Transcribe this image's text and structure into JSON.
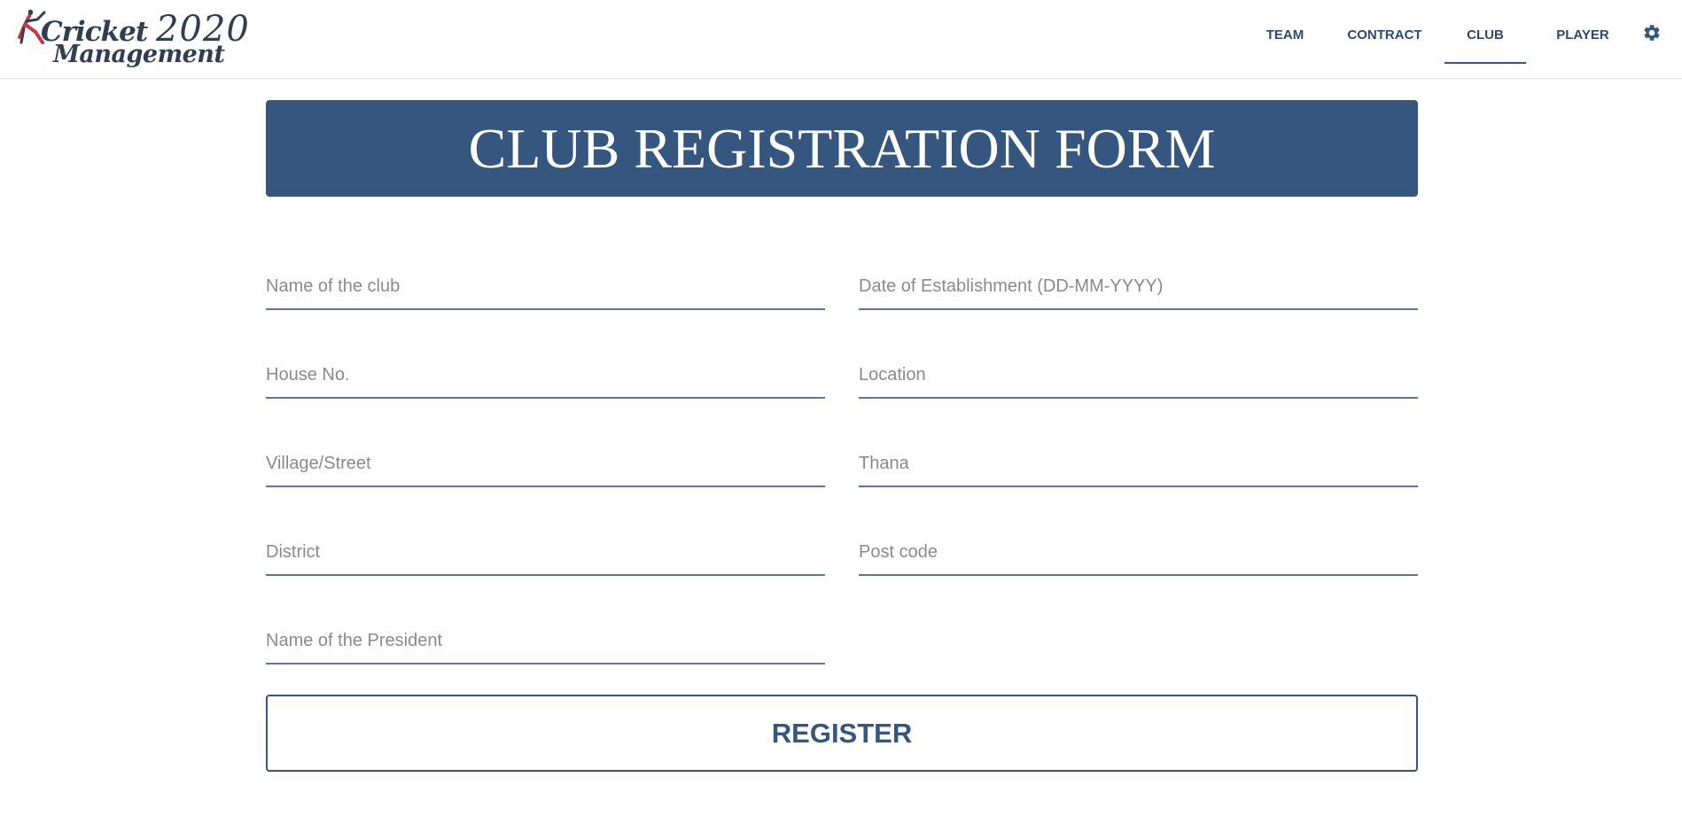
{
  "brand": {
    "line1_word": "Cricket",
    "line1_year": "2020",
    "line2": "Management",
    "icon": "cricket-player-icon"
  },
  "nav": {
    "items": [
      {
        "label": "TEAM",
        "active": false
      },
      {
        "label": "CONTRACT",
        "active": false
      },
      {
        "label": "CLUB",
        "active": true
      },
      {
        "label": "PLAYER",
        "active": false
      }
    ],
    "settings_icon": "gear-icon"
  },
  "banner": {
    "title": "CLUB REGISTRATION FORM"
  },
  "form": {
    "fields": [
      {
        "placeholder": "Name of the club",
        "value": ""
      },
      {
        "placeholder": "Date of Establishment (DD-MM-YYYY)",
        "value": ""
      },
      {
        "placeholder": "House No.",
        "value": ""
      },
      {
        "placeholder": "Location",
        "value": ""
      },
      {
        "placeholder": "Village/Street",
        "value": ""
      },
      {
        "placeholder": "Thana",
        "value": ""
      },
      {
        "placeholder": "District",
        "value": ""
      },
      {
        "placeholder": "Post code",
        "value": ""
      },
      {
        "placeholder": "Name of the President",
        "value": ""
      }
    ],
    "submit_label": "REGISTER"
  },
  "colors": {
    "primary": "#34567f",
    "nav_text": "#2e4a70",
    "placeholder": "#8a8a8a",
    "underline": "#5f7592"
  }
}
